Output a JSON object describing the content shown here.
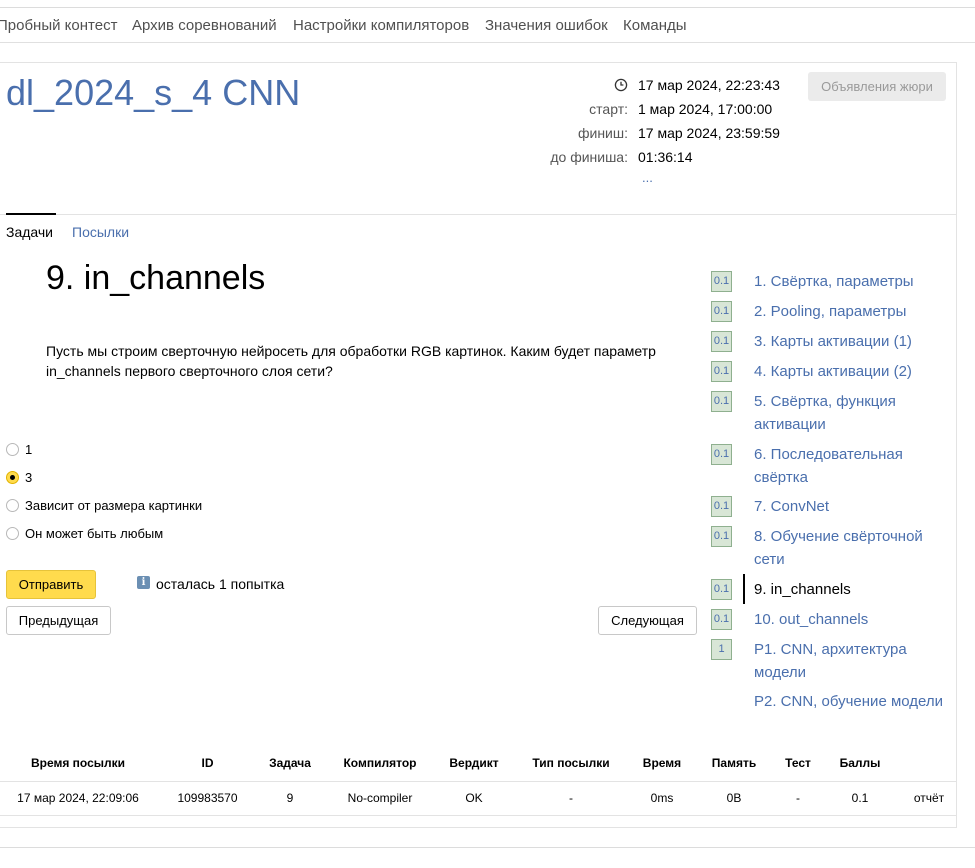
{
  "top_nav": [
    {
      "label": "Пробный контест"
    },
    {
      "label": "Архив соревнований"
    },
    {
      "label": "Настройки компиляторов"
    },
    {
      "label": "Значения ошибок"
    },
    {
      "label": "Команды"
    }
  ],
  "contest": {
    "title": "dl_2024_s_4 CNN",
    "current_time": "17 мар 2024, 22:23:43",
    "start_label": "старт:",
    "start": "1 мар 2024, 17:00:00",
    "finish_label": "финиш:",
    "finish": "17 мар 2024, 23:59:59",
    "remaining_label": "до финиша:",
    "remaining": "01:36:14",
    "more": "...",
    "jury_button": "Объявления жюри"
  },
  "tabs": {
    "problems": "Задачи",
    "submissions": "Посылки"
  },
  "problem": {
    "title": "9. in_channels",
    "statement": "Пусть мы строим сверточную нейросеть для обработки RGB картинок. Каким будет параметр in_channels первого сверточного слоя сети?",
    "options": [
      {
        "label": "1",
        "checked": false
      },
      {
        "label": "3",
        "checked": true
      },
      {
        "label": "Зависит от размера картинки",
        "checked": false
      },
      {
        "label": "Он может быть любым",
        "checked": false
      }
    ],
    "submit_label": "Отправить",
    "attempts_info": "осталась 1 попытка",
    "prev_label": "Предыдущая",
    "next_label": "Следующая"
  },
  "problem_list": [
    {
      "score": "0.1",
      "name": "1. Свёртка, параметры"
    },
    {
      "score": "0.1",
      "name": "2. Pooling, параметры"
    },
    {
      "score": "0.1",
      "name": "3. Карты активации (1)"
    },
    {
      "score": "0.1",
      "name": "4. Карты активации (2)"
    },
    {
      "score": "0.1",
      "name": "5. Свёртка, функция активации"
    },
    {
      "score": "0.1",
      "name": "6. Последовательная свёртка"
    },
    {
      "score": "0.1",
      "name": "7. ConvNet"
    },
    {
      "score": "0.1",
      "name": "8. Обучение свёрточной сети"
    },
    {
      "score": "0.1",
      "name": "9. in_channels",
      "active": true
    },
    {
      "score": "0.1",
      "name": "10. out_channels"
    },
    {
      "score": "1",
      "name": "P1. CNN, архитектура модели"
    },
    {
      "score": "",
      "name": "P2. CNN, обучение модели"
    }
  ],
  "submissions": {
    "headers": [
      "Время посылки",
      "ID",
      "Задача",
      "Компилятор",
      "Вердикт",
      "Тип посылки",
      "Время",
      "Память",
      "Тест",
      "Баллы",
      ""
    ],
    "rows": [
      [
        "17 мар 2024, 22:09:06",
        "109983570",
        "9",
        "No-compiler",
        "OK",
        "-",
        "0ms",
        "0B",
        "-",
        "0.1",
        "отчёт"
      ]
    ]
  },
  "colors": {
    "accent": "#4a6fad",
    "submit": "#ffdb4d",
    "ok": "#4b8a2e"
  }
}
